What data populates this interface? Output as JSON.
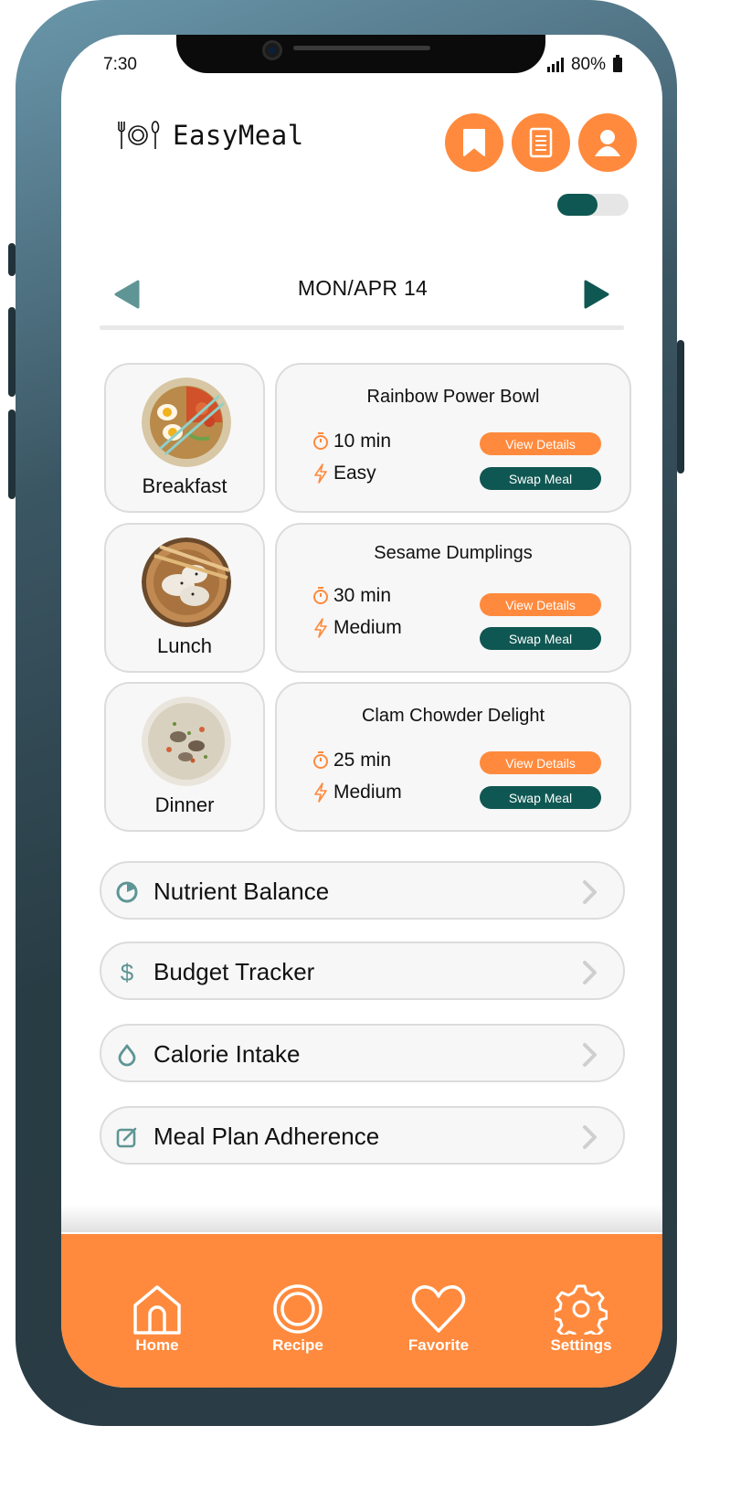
{
  "status_bar": {
    "time": "7:30",
    "battery": "80%"
  },
  "header": {
    "app_name": "EasyMeal"
  },
  "date_nav": {
    "date": "MON/APR 14"
  },
  "meals": [
    {
      "type": "Breakfast",
      "name": "Rainbow Power Bowl",
      "time": "10 min",
      "difficulty": "Easy",
      "view_label": "View Details",
      "swap_label": "Swap Meal"
    },
    {
      "type": "Lunch",
      "name": "Sesame Dumplings",
      "time": "30 min",
      "difficulty": "Medium",
      "view_label": "View Details",
      "swap_label": "Swap Meal"
    },
    {
      "type": "Dinner",
      "name": "Clam Chowder Delight",
      "time": "25 min",
      "difficulty": "Medium",
      "view_label": "View Details",
      "swap_label": "Swap Meal"
    }
  ],
  "stats": [
    {
      "label": "Nutrient Balance",
      "icon": "pie-chart-icon"
    },
    {
      "label": "Budget Tracker",
      "icon": "dollar-icon"
    },
    {
      "label": "Calorie Intake",
      "icon": "drop-icon"
    },
    {
      "label": "Meal Plan Adherence",
      "icon": "edit-square-icon"
    }
  ],
  "bottom_nav": [
    {
      "label": "Home",
      "icon": "home-icon"
    },
    {
      "label": "Recipe",
      "icon": "recipe-icon"
    },
    {
      "label": "Favorite",
      "icon": "heart-icon"
    },
    {
      "label": "Settings",
      "icon": "gear-icon"
    }
  ],
  "colors": {
    "accent": "#ff8a3d",
    "primary": "#0f5752",
    "muted_teal": "#5f9595"
  }
}
